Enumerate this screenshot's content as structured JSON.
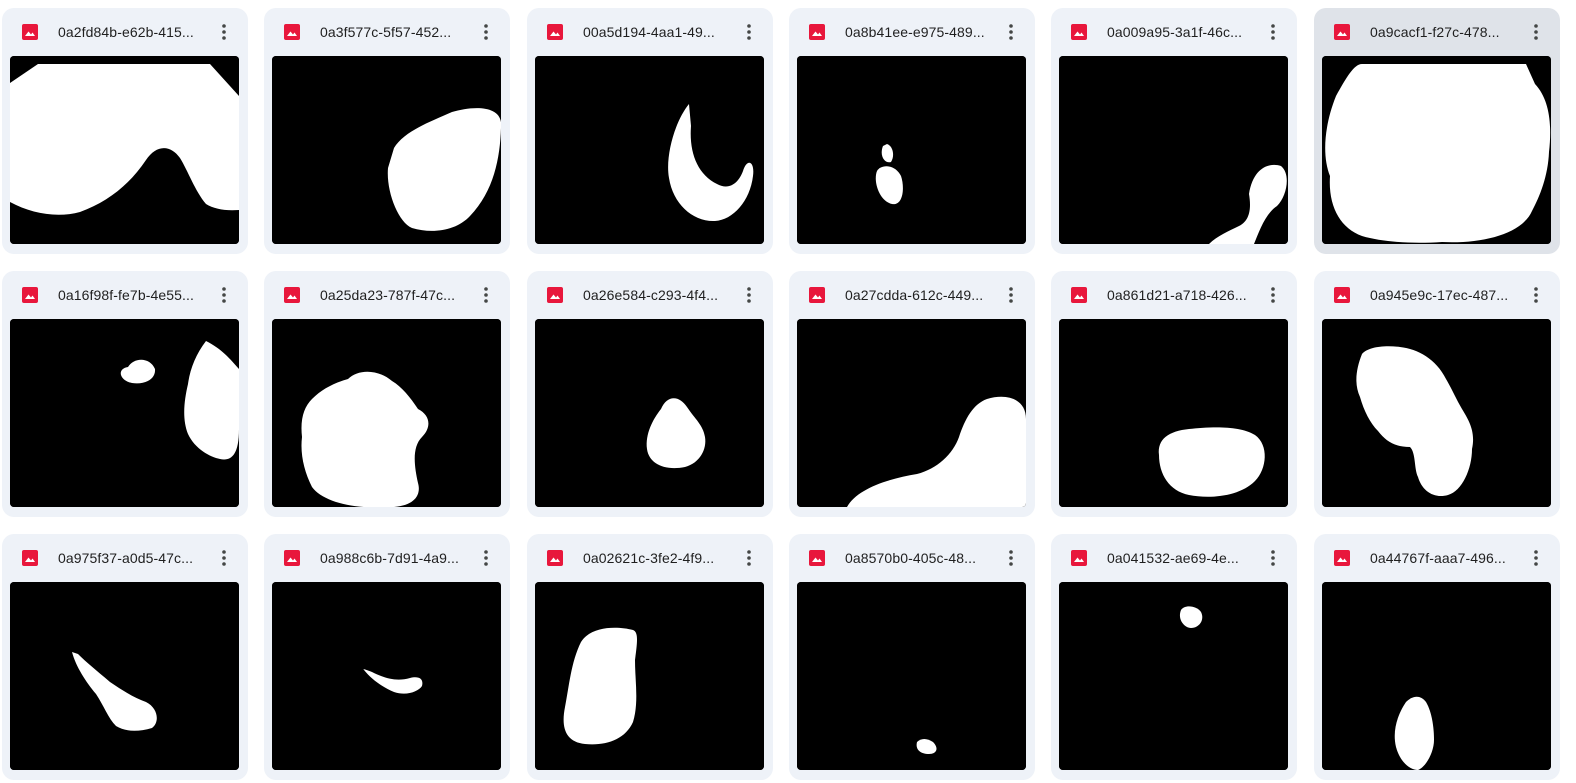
{
  "files": [
    {
      "name": "0a2fd84b-e62b-415..."
    },
    {
      "name": "0a3f577c-5f57-452..."
    },
    {
      "name": "00a5d194-4aa1-49..."
    },
    {
      "name": "0a8b41ee-e975-489..."
    },
    {
      "name": "0a009a95-3a1f-46c..."
    },
    {
      "name": "0a9cacf1-f27c-478...",
      "selected": true
    },
    {
      "name": "0a16f98f-fe7b-4e55..."
    },
    {
      "name": "0a25da23-787f-47c..."
    },
    {
      "name": "0a26e584-c293-4f4..."
    },
    {
      "name": "0a27cdda-612c-449..."
    },
    {
      "name": "0a861d21-a718-426..."
    },
    {
      "name": "0a945e9c-17ec-487..."
    },
    {
      "name": "0a975f37-a0d5-47c..."
    },
    {
      "name": "0a988c6b-7d91-4a9..."
    },
    {
      "name": "0a02621c-3fe2-4f9..."
    },
    {
      "name": "0a8570b0-405c-48..."
    },
    {
      "name": "0a041532-ae69-4e..."
    },
    {
      "name": "0a44767f-aaa7-496..."
    }
  ],
  "icons": {
    "file_type": "image-file-icon",
    "more": "more-vert-icon"
  },
  "colors": {
    "file_icon": "#e8173c",
    "card_bg": "#eef2f8",
    "card_selected_bg": "#dfe3e9",
    "thumb_bg": "#000000",
    "mask_fg": "#ffffff"
  }
}
